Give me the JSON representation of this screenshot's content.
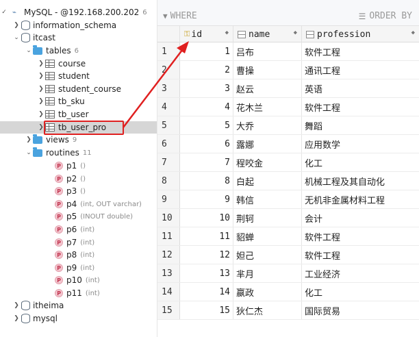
{
  "tree": {
    "connection": {
      "label": "MySQL - @192.168.200.202",
      "count": "6"
    },
    "information_schema": "information_schema",
    "itcast": "itcast",
    "tables": {
      "label": "tables",
      "count": "6"
    },
    "table_items": [
      "course",
      "student",
      "student_course",
      "tb_sku",
      "tb_user",
      "tb_user_pro"
    ],
    "views": {
      "label": "views",
      "count": "9"
    },
    "routines": {
      "label": "routines",
      "count": "11"
    },
    "routine_items": [
      {
        "name": "p1",
        "sig": "()"
      },
      {
        "name": "p2",
        "sig": "()"
      },
      {
        "name": "p3",
        "sig": "()"
      },
      {
        "name": "p4",
        "sig": "(int, OUT varchar)"
      },
      {
        "name": "p5",
        "sig": "(INOUT double)"
      },
      {
        "name": "p6",
        "sig": "(int)"
      },
      {
        "name": "p7",
        "sig": "(int)"
      },
      {
        "name": "p8",
        "sig": "(int)"
      },
      {
        "name": "p9",
        "sig": "(int)"
      },
      {
        "name": "p10",
        "sig": "(int)"
      },
      {
        "name": "p11",
        "sig": "(int)"
      }
    ],
    "itheima": "itheima",
    "mysql": "mysql"
  },
  "toolbar": {
    "where": "WHERE",
    "order_by": "ORDER BY"
  },
  "grid": {
    "columns": [
      "id",
      "name",
      "profession"
    ],
    "rows": [
      {
        "num": "1",
        "id": "1",
        "name": "吕布",
        "profession": "软件工程"
      },
      {
        "num": "2",
        "id": "2",
        "name": "曹操",
        "profession": "通讯工程"
      },
      {
        "num": "3",
        "id": "3",
        "name": "赵云",
        "profession": "英语"
      },
      {
        "num": "4",
        "id": "4",
        "name": "花木兰",
        "profession": "软件工程"
      },
      {
        "num": "5",
        "id": "5",
        "name": "大乔",
        "profession": "舞蹈"
      },
      {
        "num": "6",
        "id": "6",
        "name": "露娜",
        "profession": "应用数学"
      },
      {
        "num": "7",
        "id": "7",
        "name": "程咬金",
        "profession": "化工"
      },
      {
        "num": "8",
        "id": "8",
        "name": "白起",
        "profession": "机械工程及其自动化"
      },
      {
        "num": "9",
        "id": "9",
        "name": "韩信",
        "profession": "无机非金属材料工程"
      },
      {
        "num": "10",
        "id": "10",
        "name": "荆轲",
        "profession": "会计"
      },
      {
        "num": "11",
        "id": "11",
        "name": "貂蝉",
        "profession": "软件工程"
      },
      {
        "num": "12",
        "id": "12",
        "name": "妲己",
        "profession": "软件工程"
      },
      {
        "num": "13",
        "id": "13",
        "name": "芈月",
        "profession": "工业经济"
      },
      {
        "num": "14",
        "id": "14",
        "name": "嬴政",
        "profession": "化工"
      },
      {
        "num": "15",
        "id": "15",
        "name": "狄仁杰",
        "profession": "国际贸易"
      }
    ]
  },
  "colors": {
    "accent_red": "#e02020",
    "folder_blue": "#4aa3df",
    "selected_row": "#d6d6d6"
  }
}
